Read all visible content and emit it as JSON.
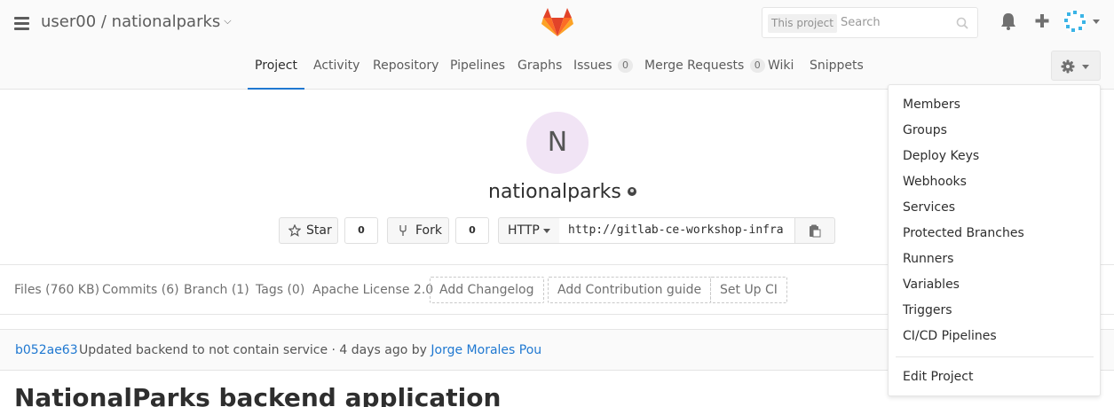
{
  "header": {
    "project_path": "user00 / nationalparks",
    "search_scope": "This project",
    "search_placeholder": "Search"
  },
  "tabs": [
    {
      "label": "Project"
    },
    {
      "label": "Activity"
    },
    {
      "label": "Repository"
    },
    {
      "label": "Pipelines"
    },
    {
      "label": "Graphs"
    },
    {
      "label": "Issues",
      "count": "0"
    },
    {
      "label": "Merge Requests",
      "count": "0"
    },
    {
      "label": "Wiki"
    },
    {
      "label": "Snippets"
    }
  ],
  "project": {
    "avatar_letter": "N",
    "name": "nationalparks",
    "star_label": "Star",
    "star_count": "0",
    "fork_label": "Fork",
    "fork_count": "0",
    "protocol": "HTTP",
    "clone_url": "http://gitlab-ce-workshop-infra"
  },
  "stats": {
    "files": "Files (760 KB)",
    "commits": "Commits (6)",
    "branch": "Branch (1)",
    "tags": "Tags (0)",
    "license": "Apache License 2.0",
    "add_changelog": "Add Changelog",
    "add_contribution": "Add Contribution guide",
    "setup_ci": "Set Up CI"
  },
  "commit": {
    "sha": "b052ae63",
    "message": "Updated backend to not contain service · 4 days ago by ",
    "author": "Jorge Morales Pou"
  },
  "readme": {
    "title": "NationalParks backend application"
  },
  "settings_menu": {
    "items": [
      "Members",
      "Groups",
      "Deploy Keys",
      "Webhooks",
      "Services",
      "Protected Branches",
      "Runners",
      "Variables",
      "Triggers",
      "CI/CD Pipelines"
    ],
    "edit_project": "Edit Project"
  },
  "colors": {
    "accent": "#1f78d1",
    "avatar_bg": "#f1e4f5"
  }
}
